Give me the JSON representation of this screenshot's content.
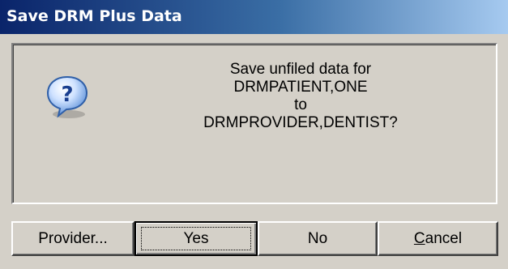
{
  "window": {
    "title": "Save DRM Plus Data"
  },
  "message": {
    "icon": "question-icon",
    "lines": [
      "Save unfiled data for",
      "DRMPATIENT,ONE",
      "to",
      "DRMPROVIDER,DENTIST?"
    ]
  },
  "buttons": {
    "provider_label": "Provider...",
    "yes_label": "Yes",
    "no_label": "No",
    "cancel_mnemonic": "C",
    "cancel_rest": "ancel"
  },
  "colors": {
    "titlebar_start": "#0a246a",
    "titlebar_end": "#a6caf0",
    "face": "#d4d0c8",
    "icon_blue": "#2f6fd0"
  }
}
